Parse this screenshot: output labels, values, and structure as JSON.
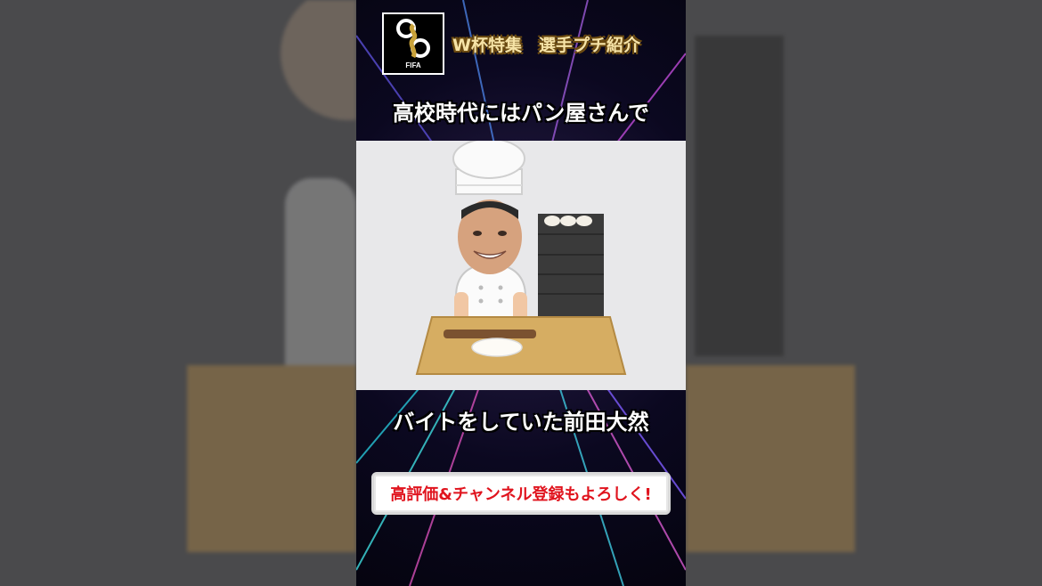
{
  "logo": {
    "text": "FIFA",
    "icon": "world-cup-trophy-icon"
  },
  "header": {
    "label": "W杯特集　選手プチ紹介"
  },
  "captions": {
    "top": "高校時代にはパン屋さんで",
    "bottom": "バイトをしていた前田大然"
  },
  "cta": {
    "label": "高評価&チャンネル登録もよろしく!"
  },
  "colors": {
    "header_text": "#f6e3a6",
    "cta_text": "#e0141e",
    "illustration_bg": "#e8e8ea",
    "frame_bg": "#0b0820"
  }
}
